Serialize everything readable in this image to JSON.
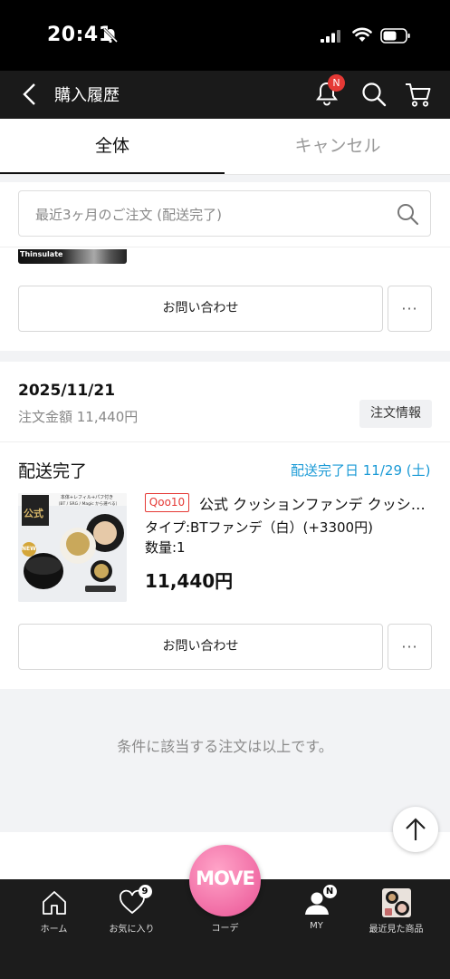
{
  "status_bar": {
    "time": "20:41"
  },
  "header": {
    "title": "購入履歴",
    "notification_badge": "N"
  },
  "tabs": [
    {
      "label": "全体",
      "active": true
    },
    {
      "label": "キャンセル",
      "active": false
    }
  ],
  "search": {
    "placeholder": "最近3ヶ月のご注文 (配送完了)"
  },
  "previous_order": {
    "thumb_text": "Thinsulate",
    "inquiry_label": "お問い合わせ",
    "more_label": "···"
  },
  "order": {
    "date": "2025/11/21",
    "amount": "注文金額 11,440円",
    "info_button": "注文情報",
    "status": "配送完了",
    "delivery_date": "配送完了日 11/29 (土)",
    "shop_tag": "Qoo10",
    "product_name": "公式 クッションファンデ クッションファンデーション",
    "option": "タイプ:BTファンデ（白）(+3300円)",
    "quantity": "数量:1",
    "price": "11,440円",
    "image_text": {
      "top": "本体+レフィル+パフ付き",
      "sub": "（BT / SRG / Magic から選べる）",
      "badge": "公式",
      "new": "NEW"
    },
    "inquiry_label": "お問い合わせ",
    "more_label": "···"
  },
  "end_message": "条件に該当する注文は以上です。",
  "colors": {
    "accent_blue": "#1a9ad6",
    "tag_red": "#e53935",
    "move_pink": "#f06ba4"
  },
  "bottom_nav": {
    "items": [
      {
        "label": "ホーム",
        "icon": "home-icon"
      },
      {
        "label": "お気に入り",
        "icon": "heart-icon",
        "badge": "9"
      },
      {
        "label": "コーデ",
        "icon": "move-logo"
      },
      {
        "label": "MY",
        "icon": "person-icon",
        "badge": "N"
      },
      {
        "label": "最近見た商品",
        "icon": "recent-product-thumb"
      }
    ],
    "move_text": "MOVE"
  }
}
